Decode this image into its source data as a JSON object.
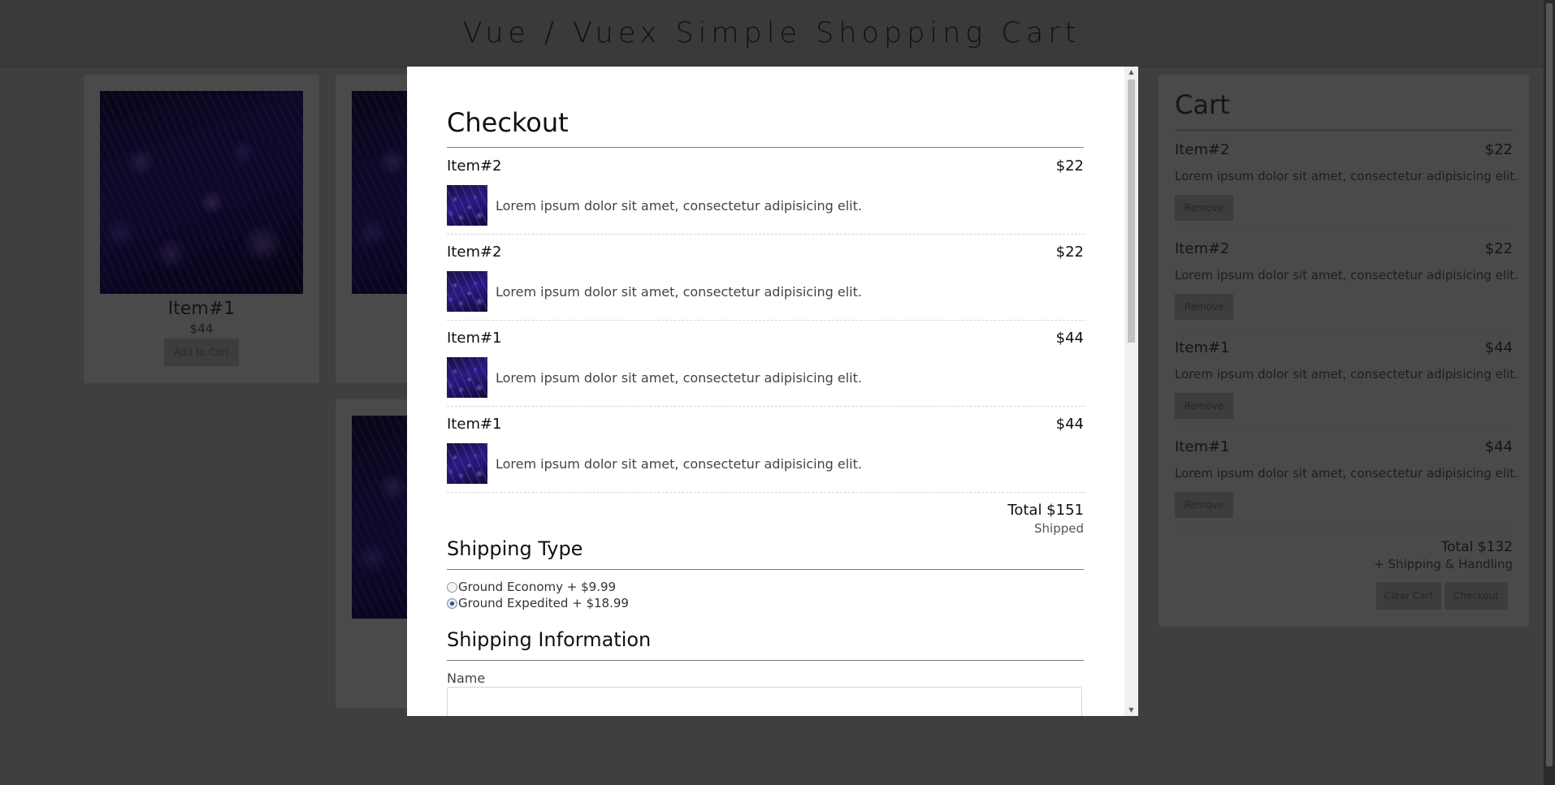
{
  "app": {
    "title": "Vue / Vuex Simple Shopping Cart"
  },
  "products": [
    {
      "name": "Item#1",
      "price": "$44",
      "button": "Add to Cart"
    }
  ],
  "cart": {
    "title": "Cart",
    "items": [
      {
        "name": "Item#2",
        "price": "$22",
        "description": "Lorem ipsum dolor sit amet, consectetur adipisicing elit.",
        "remove_label": "Remove"
      },
      {
        "name": "Item#2",
        "price": "$22",
        "description": "Lorem ipsum dolor sit amet, consectetur adipisicing elit.",
        "remove_label": "Remove"
      },
      {
        "name": "Item#1",
        "price": "$44",
        "description": "Lorem ipsum dolor sit amet, consectetur adipisicing elit.",
        "remove_label": "Remove"
      },
      {
        "name": "Item#1",
        "price": "$44",
        "description": "Lorem ipsum dolor sit amet, consectetur adipisicing elit.",
        "remove_label": "Remove"
      }
    ],
    "total": "Total $132",
    "shipping_note": "+ Shipping & Handling",
    "clear_label": "Clear Cart",
    "checkout_label": "Checkout"
  },
  "checkout": {
    "title": "Checkout",
    "items": [
      {
        "name": "Item#2",
        "price": "$22",
        "description": "Lorem ipsum dolor sit amet, consectetur adipisicing elit."
      },
      {
        "name": "Item#2",
        "price": "$22",
        "description": "Lorem ipsum dolor sit amet, consectetur adipisicing elit."
      },
      {
        "name": "Item#1",
        "price": "$44",
        "description": "Lorem ipsum dolor sit amet, consectetur adipisicing elit."
      },
      {
        "name": "Item#1",
        "price": "$44",
        "description": "Lorem ipsum dolor sit amet, consectetur adipisicing elit."
      }
    ],
    "total": "Total $151",
    "status": "Shipped",
    "shipping_type_title": "Shipping Type",
    "shipping_options": [
      {
        "label": "Ground Economy + $9.99",
        "selected": false
      },
      {
        "label": "Ground Expedited + $18.99",
        "selected": true
      }
    ],
    "shipping_info_title": "Shipping Information",
    "name_label": "Name",
    "name_value": ""
  }
}
